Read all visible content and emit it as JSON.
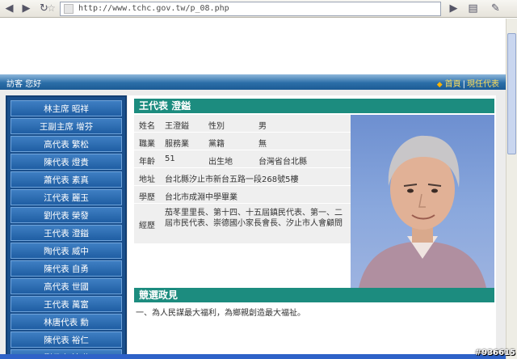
{
  "browser": {
    "url": "http://www.tchc.gov.tw/p_08.php",
    "back_icon": "back-arrow-icon",
    "forward_icon": "forward-arrow-icon",
    "reload_icon": "reload-icon",
    "star_icon": "bookmark-star-icon",
    "page_icon": "page-menu-icon",
    "tools_icon": "tools-wrench-icon"
  },
  "topbar": {
    "visitor": "訪客  您好",
    "home_link": "首頁",
    "current_link": "現任代表"
  },
  "sidebar": {
    "items": [
      {
        "label": "林主席  昭祥"
      },
      {
        "label": "王副主席  增芬"
      },
      {
        "label": "高代表  繁松"
      },
      {
        "label": "陳代表  燈貴"
      },
      {
        "label": "蕭代表  素真"
      },
      {
        "label": "江代表  麗玉"
      },
      {
        "label": "劉代表  榮發"
      },
      {
        "label": "王代表  澄鎰"
      },
      {
        "label": "陶代表  威中"
      },
      {
        "label": "陳代表  自勇"
      },
      {
        "label": "高代表  世國"
      },
      {
        "label": "王代表  萬富"
      },
      {
        "label": "林唐代表  勳"
      },
      {
        "label": "陳代表  裕仁"
      },
      {
        "label": "劉代表  沛琳"
      }
    ]
  },
  "profile": {
    "title": "王代表  澄鎰",
    "name_label": "姓名",
    "name": "王澄鎰",
    "gender_label": "性別",
    "gender": "男",
    "job_label": "職業",
    "job": "服務業",
    "party_label": "黨籍",
    "party": "無",
    "age_label": "年齡",
    "age": "51",
    "birthplace_label": "出生地",
    "birthplace": "台灣省台北縣",
    "address_label": "地址",
    "address": "台北縣汐止市新台五路一段268號5樓",
    "education_label": "學歷",
    "education": "台北市成淵中學畢業",
    "experience_label": "經歷",
    "experience": "茄苳里里長、第十四、十五屆鎮民代表、第一、二屆市民代表、崇德國小家長會長、汐止市人會顧問"
  },
  "platform": {
    "title": "競選政見",
    "text": "一、為人民謀最大福利，為鄉親創造最大福祉。"
  },
  "watermark": "#936615"
}
